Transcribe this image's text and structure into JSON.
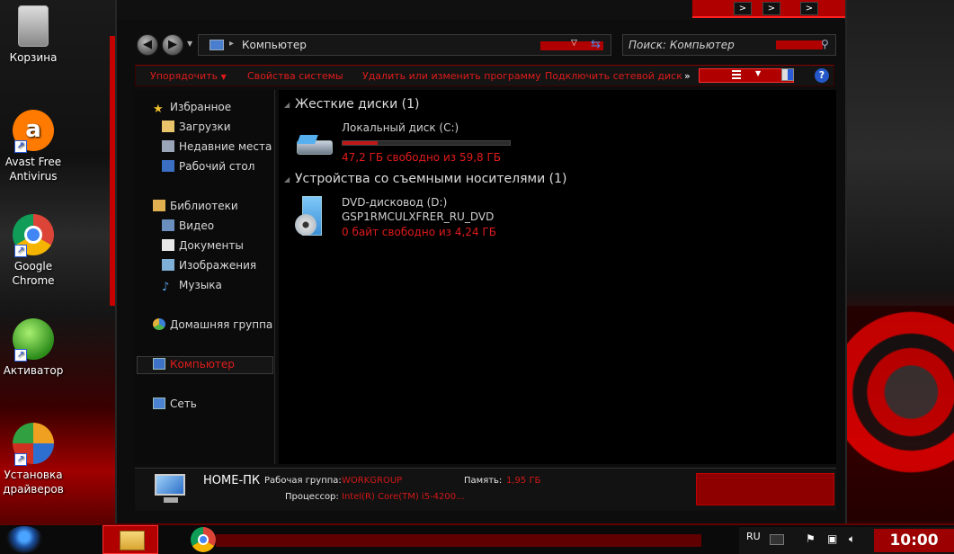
{
  "desktop": {
    "icons": [
      {
        "label": "Корзина",
        "icon": "recycle-bin-icon"
      },
      {
        "label": "Avast Free Antivirus",
        "icon": "avast-icon"
      },
      {
        "label": "Google Chrome",
        "icon": "chrome-icon"
      },
      {
        "label": "Активатор",
        "icon": "activator-icon"
      },
      {
        "label": "Установка драйверов",
        "icon": "driver-install-icon"
      }
    ]
  },
  "window": {
    "title_buttons": [
      ">",
      ">",
      ">"
    ],
    "address": {
      "path": "Компьютер"
    },
    "search": {
      "placeholder": "Поиск: Компьютер"
    },
    "toolbar": {
      "organize": "Упорядочить",
      "system_properties": "Свойства системы",
      "uninstall": "Удалить или изменить программу",
      "map_drive": "Подключить сетевой диск",
      "more": "»"
    },
    "nav": {
      "favorites": "Избранное",
      "downloads": "Загрузки",
      "recent": "Недавние места",
      "desktop": "Рабочий стол",
      "libraries": "Библиотеки",
      "video": "Видео",
      "documents": "Документы",
      "images": "Изображения",
      "music": "Музыка",
      "homegroup": "Домашняя группа",
      "computer": "Компьютер",
      "network": "Сеть"
    },
    "groups": {
      "hdd": {
        "title": "Жесткие диски (1)",
        "drive_name": "Локальный диск (C:)",
        "free": "47,2 ГБ свободно из 59,8 ГБ",
        "used_fraction": 0.21
      },
      "removable": {
        "title": "Устройства со съемными носителями (1)",
        "drive_name": "DVD-дисковод (D:)",
        "label": "GSP1RMCULXFRER_RU_DVD",
        "free": "0 байт свободно из 4,24 ГБ"
      }
    },
    "details": {
      "name": "HOME-ПК",
      "workgroup_label": "Рабочая группа:",
      "workgroup_value": "WORKGROUP",
      "memory_label": "Память:",
      "memory_value": "1,95 ГБ",
      "cpu_label": "Процессор:",
      "cpu_value": "Intel(R) Core(TM) i5-4200..."
    }
  },
  "taskbar": {
    "lang": "RU",
    "time": "10:00"
  },
  "colors": {
    "accent": "#e01b1b",
    "accent_dark": "#b00000"
  }
}
